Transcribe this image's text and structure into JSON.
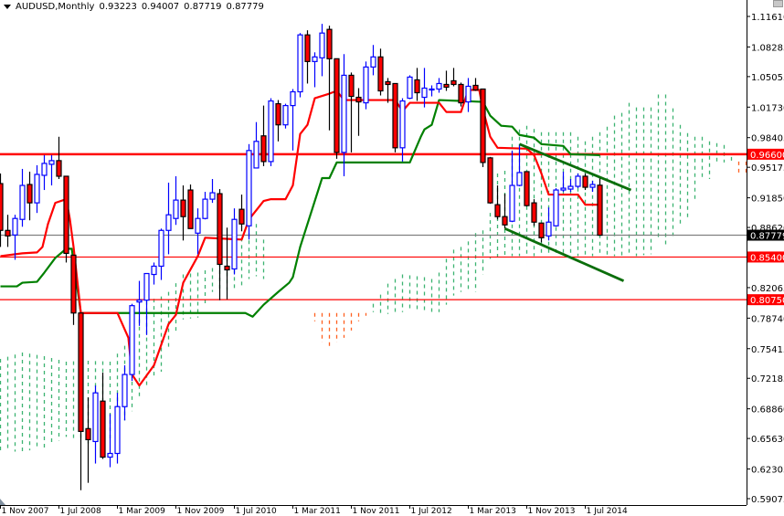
{
  "header": {
    "symbol_period": "AUDUSD,Monthly",
    "open": "0.93223",
    "high": "0.94007",
    "low": "0.87719",
    "close": "0.87779"
  },
  "colors": {
    "bull": "#0000ff",
    "bear": "#ff0000",
    "tenkan": "#ff0000",
    "kijun": "#008000",
    "cloud_bull": "#3cb371",
    "cloud_bear": "#ff6020",
    "trend": "#0b6e0b",
    "level": "#ff0000",
    "bid": "#808080"
  },
  "chart_data": {
    "type": "candlestick",
    "title": "AUDUSD,Monthly",
    "first_bar": "1 Nov 2007",
    "ylim": [
      0.59075,
      1.1161
    ],
    "y_ticks": [
      "1.11610",
      "1.08285",
      "1.05055",
      "1.01730",
      "0.98405",
      "0.95175",
      "0.91850",
      "0.88620",
      "0.82065",
      "0.78740",
      "0.75415",
      "0.72185",
      "0.68860",
      "0.65630",
      "0.62305",
      "0.59075"
    ],
    "x_ticks": [
      {
        "label": "1 Nov 2007",
        "bar": 0
      },
      {
        "label": "1 Jul 2008",
        "bar": 8
      },
      {
        "label": "1 Mar 2009",
        "bar": 16
      },
      {
        "label": "1 Nov 2009",
        "bar": 24
      },
      {
        "label": "1 Jul 2010",
        "bar": 32
      },
      {
        "label": "1 Mar 2011",
        "bar": 40
      },
      {
        "label": "1 Nov 2011",
        "bar": 48
      },
      {
        "label": "1 Jul 2012",
        "bar": 56
      },
      {
        "label": "1 Mar 2013",
        "bar": 64
      },
      {
        "label": "1 Nov 2013",
        "bar": 72
      },
      {
        "label": "1 Jul 2014",
        "bar": 80
      }
    ],
    "candles_ohlc": [
      [
        0.934,
        0.945,
        0.865,
        0.883
      ],
      [
        0.883,
        0.9,
        0.865,
        0.877
      ],
      [
        0.878,
        0.9,
        0.851,
        0.896
      ],
      [
        0.895,
        0.95,
        0.887,
        0.932
      ],
      [
        0.933,
        0.947,
        0.894,
        0.913
      ],
      [
        0.913,
        0.954,
        0.902,
        0.944
      ],
      [
        0.943,
        0.965,
        0.927,
        0.956
      ],
      [
        0.955,
        0.965,
        0.932,
        0.959
      ],
      [
        0.959,
        0.985,
        0.939,
        0.942
      ],
      [
        0.942,
        0.942,
        0.848,
        0.858
      ],
      [
        0.856,
        0.856,
        0.78,
        0.793
      ],
      [
        0.793,
        0.793,
        0.6,
        0.664
      ],
      [
        0.667,
        0.701,
        0.608,
        0.655
      ],
      [
        0.653,
        0.714,
        0.629,
        0.706
      ],
      [
        0.697,
        0.728,
        0.634,
        0.636
      ],
      [
        0.636,
        0.683,
        0.625,
        0.64
      ],
      [
        0.64,
        0.706,
        0.629,
        0.691
      ],
      [
        0.691,
        0.736,
        0.676,
        0.726
      ],
      [
        0.726,
        0.803,
        0.719,
        0.801
      ],
      [
        0.805,
        0.828,
        0.779,
        0.807
      ],
      [
        0.807,
        0.836,
        0.769,
        0.836
      ],
      [
        0.835,
        0.848,
        0.824,
        0.844
      ],
      [
        0.844,
        0.885,
        0.829,
        0.883
      ],
      [
        0.883,
        0.935,
        0.857,
        0.9
      ],
      [
        0.896,
        0.942,
        0.889,
        0.916
      ],
      [
        0.916,
        0.932,
        0.872,
        0.898
      ],
      [
        0.927,
        0.933,
        0.885,
        0.885
      ],
      [
        0.88,
        0.907,
        0.857,
        0.896
      ],
      [
        0.896,
        0.925,
        0.895,
        0.917
      ],
      [
        0.917,
        0.939,
        0.913,
        0.924
      ],
      [
        0.923,
        0.928,
        0.807,
        0.846
      ],
      [
        0.844,
        0.886,
        0.808,
        0.84
      ],
      [
        0.841,
        0.907,
        0.835,
        0.895
      ],
      [
        0.906,
        0.922,
        0.882,
        0.89
      ],
      [
        0.888,
        0.977,
        0.873,
        0.97
      ],
      [
        0.951,
        1.001,
        0.951,
        0.98
      ],
      [
        0.986,
        1.019,
        0.953,
        0.958
      ],
      [
        0.958,
        1.027,
        0.953,
        1.024
      ],
      [
        1.021,
        1.025,
        0.98,
        0.998
      ],
      [
        0.998,
        1.021,
        0.994,
        1.019
      ],
      [
        1.019,
        1.037,
        0.97,
        1.034
      ],
      [
        1.034,
        1.098,
        1.028,
        1.096
      ],
      [
        1.096,
        1.101,
        1.043,
        1.067
      ],
      [
        1.067,
        1.077,
        1.039,
        1.072
      ],
      [
        1.071,
        1.108,
        1.051,
        1.098
      ],
      [
        1.102,
        1.106,
        0.992,
        1.07
      ],
      [
        1.07,
        1.07,
        0.961,
        0.968
      ],
      [
        0.968,
        1.075,
        0.942,
        1.052
      ],
      [
        1.052,
        1.055,
        0.968,
        1.029
      ],
      [
        1.028,
        1.038,
        0.986,
        1.023
      ],
      [
        1.022,
        1.067,
        1.015,
        1.061
      ],
      [
        1.061,
        1.085,
        1.052,
        1.072
      ],
      [
        1.072,
        1.081,
        1.03,
        1.035
      ],
      [
        1.045,
        1.049,
        1.022,
        1.042
      ],
      [
        1.043,
        1.043,
        0.968,
        0.973
      ],
      [
        0.973,
        1.027,
        0.958,
        1.024
      ],
      [
        1.027,
        1.052,
        1.026,
        1.05
      ],
      [
        1.047,
        1.06,
        1.024,
        1.033
      ],
      [
        1.028,
        1.06,
        1.017,
        1.038
      ],
      [
        1.036,
        1.041,
        1.029,
        1.037
      ],
      [
        1.037,
        1.049,
        1.033,
        1.043
      ],
      [
        1.042,
        1.057,
        1.035,
        1.039
      ],
      [
        1.046,
        1.06,
        1.04,
        1.042
      ],
      [
        1.042,
        1.044,
        1.018,
        1.022
      ],
      [
        1.023,
        1.049,
        1.012,
        1.04
      ],
      [
        1.041,
        1.049,
        1.035,
        1.036
      ],
      [
        1.037,
        1.037,
        0.952,
        0.957
      ],
      [
        0.962,
        0.963,
        0.912,
        0.913
      ],
      [
        0.911,
        0.932,
        0.895,
        0.898
      ],
      [
        0.898,
        0.923,
        0.885,
        0.889
      ],
      [
        0.893,
        0.97,
        0.892,
        0.932
      ],
      [
        0.932,
        0.977,
        0.931,
        0.946
      ],
      [
        0.947,
        0.947,
        0.909,
        0.91
      ],
      [
        0.913,
        0.917,
        0.888,
        0.892
      ],
      [
        0.891,
        0.891,
        0.87,
        0.875
      ],
      [
        0.877,
        0.908,
        0.872,
        0.892
      ],
      [
        0.888,
        0.929,
        0.887,
        0.927
      ],
      [
        0.927,
        0.947,
        0.925,
        0.929
      ],
      [
        0.928,
        0.939,
        0.925,
        0.931
      ],
      [
        0.931,
        0.945,
        0.929,
        0.942
      ],
      [
        0.942,
        0.945,
        0.927,
        0.93
      ],
      [
        0.93,
        0.937,
        0.925,
        0.933
      ],
      [
        0.93223,
        0.94007,
        0.87719,
        0.87779
      ]
    ],
    "tenkan_sen": [
      [
        0,
        0.855
      ],
      [
        3,
        0.858
      ],
      [
        5,
        0.859
      ],
      [
        5.75,
        0.865
      ],
      [
        6.5,
        0.89
      ],
      [
        7.5,
        0.913
      ],
      [
        9,
        0.917
      ],
      [
        9.5,
        0.895
      ],
      [
        10,
        0.865
      ],
      [
        11,
        0.793
      ],
      [
        16,
        0.793
      ],
      [
        17.5,
        0.766
      ],
      [
        18,
        0.726
      ],
      [
        19,
        0.714
      ],
      [
        21,
        0.736
      ],
      [
        23,
        0.781
      ],
      [
        24,
        0.791
      ],
      [
        25,
        0.826
      ],
      [
        27,
        0.855
      ],
      [
        28,
        0.875
      ],
      [
        33,
        0.873
      ],
      [
        34,
        0.895
      ],
      [
        35,
        0.905
      ],
      [
        36,
        0.915
      ],
      [
        37,
        0.917
      ],
      [
        39,
        0.917
      ],
      [
        40,
        0.932
      ],
      [
        41,
        0.988
      ],
      [
        42,
        0.998
      ],
      [
        43,
        1.027
      ],
      [
        45,
        1.032
      ],
      [
        46,
        1.035
      ],
      [
        47,
        1.025
      ],
      [
        54,
        1.025
      ],
      [
        55,
        1.013
      ],
      [
        56,
        1.022
      ],
      [
        60,
        1.022
      ],
      [
        61,
        1.012
      ],
      [
        63,
        1.012
      ],
      [
        64,
        1.036
      ],
      [
        65.5,
        1.036
      ],
      [
        66,
        1.015
      ],
      [
        67,
        0.985
      ],
      [
        68,
        0.973
      ],
      [
        72,
        0.972
      ],
      [
        73,
        0.965
      ],
      [
        74,
        0.945
      ],
      [
        75,
        0.922
      ],
      [
        79,
        0.922
      ],
      [
        80,
        0.911
      ],
      [
        82,
        0.911
      ]
    ],
    "kijun_sen": [
      [
        0,
        0.822
      ],
      [
        2.25,
        0.822
      ],
      [
        3,
        0.826
      ],
      [
        5,
        0.827
      ],
      [
        6,
        0.837
      ],
      [
        7.5,
        0.853
      ],
      [
        9,
        0.863
      ],
      [
        9.75,
        0.863
      ],
      [
        11,
        0.793
      ],
      [
        33.5,
        0.793
      ],
      [
        34.5,
        0.789
      ],
      [
        36,
        0.802
      ],
      [
        38,
        0.816
      ],
      [
        39.5,
        0.826
      ],
      [
        40,
        0.832
      ],
      [
        41,
        0.865
      ],
      [
        42,
        0.89
      ],
      [
        43,
        0.915
      ],
      [
        44,
        0.94
      ],
      [
        45,
        0.94
      ],
      [
        46,
        0.957
      ],
      [
        56,
        0.957
      ],
      [
        57.5,
        0.985
      ],
      [
        58,
        0.993
      ],
      [
        59,
        0.998
      ],
      [
        60,
        1.025
      ],
      [
        66,
        1.023
      ],
      [
        67,
        1.008
      ],
      [
        68.5,
        0.997
      ],
      [
        70,
        0.996
      ],
      [
        71,
        0.987
      ],
      [
        73,
        0.984
      ],
      [
        74,
        0.977
      ],
      [
        77,
        0.975
      ],
      [
        78,
        0.966
      ],
      [
        82,
        0.965
      ]
    ],
    "cloud": [
      [
        0,
        0.743,
        0.642,
        "bull"
      ],
      [
        3,
        0.75,
        0.642,
        "bull"
      ],
      [
        6,
        0.746,
        0.646,
        "bull"
      ],
      [
        9,
        0.74,
        0.658,
        "bull"
      ],
      [
        12,
        0.741,
        0.651,
        "bull"
      ],
      [
        15,
        0.74,
        0.656,
        "bull"
      ],
      [
        18,
        0.766,
        0.686,
        "bull"
      ],
      [
        20,
        0.806,
        0.713,
        "bull"
      ],
      [
        22,
        0.811,
        0.729,
        "bull"
      ],
      [
        23,
        0.816,
        0.756,
        "bull"
      ],
      [
        25,
        0.835,
        0.786,
        "bull"
      ],
      [
        27,
        0.837,
        0.788,
        "bull"
      ],
      [
        29,
        0.842,
        0.816,
        "bull"
      ],
      [
        31,
        0.853,
        0.818,
        "bull"
      ],
      [
        33,
        0.875,
        0.822,
        "bull"
      ],
      [
        34,
        0.88,
        0.83,
        "bull"
      ],
      [
        35,
        0.89,
        0.833,
        "bull"
      ],
      [
        36,
        0.873,
        0.83,
        "bull"
      ],
      [
        37,
        0.85,
        0.85,
        "none"
      ],
      [
        42,
        0.8,
        0.8,
        "none"
      ],
      [
        43,
        0.793,
        0.784,
        "bear"
      ],
      [
        44,
        0.793,
        0.761,
        "bear"
      ],
      [
        45,
        0.793,
        0.754,
        "bear"
      ],
      [
        46,
        0.793,
        0.761,
        "bear"
      ],
      [
        47,
        0.793,
        0.766,
        "bear"
      ],
      [
        48,
        0.793,
        0.774,
        "bear"
      ],
      [
        49,
        0.793,
        0.784,
        "bear"
      ],
      [
        50,
        0.793,
        0.79,
        "bear"
      ],
      [
        51,
        0.803,
        0.794,
        "bull"
      ],
      [
        52,
        0.813,
        0.793,
        "bull"
      ],
      [
        53,
        0.825,
        0.792,
        "bull"
      ],
      [
        55,
        0.835,
        0.794,
        "bull"
      ],
      [
        58,
        0.832,
        0.795,
        "bull"
      ],
      [
        59,
        0.83,
        0.794,
        "bull"
      ],
      [
        60,
        0.837,
        0.794,
        "bull"
      ],
      [
        61,
        0.852,
        0.802,
        "bull"
      ],
      [
        62,
        0.862,
        0.812,
        "bull"
      ],
      [
        63,
        0.865,
        0.816,
        "bull"
      ],
      [
        64,
        0.871,
        0.816,
        "bull"
      ],
      [
        65,
        0.88,
        0.816,
        "bull"
      ],
      [
        66,
        0.883,
        0.835,
        "bull"
      ],
      [
        67,
        0.902,
        0.852,
        "bull"
      ],
      [
        68,
        0.945,
        0.852,
        "bull"
      ],
      [
        69,
        0.948,
        0.855,
        "bull"
      ],
      [
        70,
        0.985,
        0.855,
        "bull"
      ],
      [
        71,
        0.993,
        0.855,
        "bull"
      ],
      [
        72,
        0.997,
        0.855,
        "bull"
      ],
      [
        74,
        0.99,
        0.855,
        "bull"
      ],
      [
        78,
        0.99,
        0.855,
        "bull"
      ],
      [
        79,
        0.985,
        0.855,
        "bull"
      ],
      [
        80,
        0.98,
        0.855,
        "bull"
      ],
      [
        81,
        0.985,
        0.855,
        "bull"
      ],
      [
        82,
        0.99,
        0.855,
        "bull"
      ],
      [
        83,
        0.996,
        0.855,
        "bull"
      ],
      [
        84,
        1.008,
        0.855,
        "bull"
      ],
      [
        85,
        1.011,
        0.855,
        "bull"
      ],
      [
        86,
        1.022,
        0.855,
        "bull"
      ],
      [
        87,
        1.017,
        0.855,
        "bull"
      ],
      [
        89,
        1.017,
        0.857,
        "bull"
      ],
      [
        90,
        1.031,
        0.875,
        "bull"
      ],
      [
        91,
        1.031,
        0.866,
        "bull"
      ],
      [
        92,
        1.016,
        0.877,
        "bull"
      ],
      [
        93,
        0.998,
        0.887,
        "bull"
      ],
      [
        94,
        0.989,
        0.896,
        "bull"
      ],
      [
        95,
        0.985,
        0.917,
        "bull"
      ],
      [
        96,
        0.985,
        0.938,
        "bull"
      ],
      [
        97,
        0.98,
        0.939,
        "bull"
      ],
      [
        98,
        0.978,
        0.957,
        "bull"
      ],
      [
        99,
        0.976,
        0.957,
        "bull"
      ],
      [
        100,
        0.963,
        0.957,
        "bull"
      ],
      [
        101,
        0.958,
        0.945,
        "bear"
      ],
      [
        102,
        0.958,
        0.945,
        "bear"
      ]
    ],
    "trendlines": [
      {
        "name": "upper-channel",
        "from": [
          71,
          0.977
        ],
        "to": [
          86.25,
          0.927
        ]
      },
      {
        "name": "lower-channel",
        "from": [
          69,
          0.885
        ],
        "to": [
          85.25,
          0.828
        ]
      }
    ],
    "levels": [
      {
        "price": 0.966,
        "label": "0.96600",
        "style": "resistance",
        "thick": true
      },
      {
        "price": 0.854,
        "label": "0.85400",
        "style": "support",
        "thick": false
      },
      {
        "price": 0.8075,
        "label": "0.80750",
        "style": "support",
        "thick": false
      },
      {
        "price": 0.87779,
        "label": "0.87779",
        "style": "bid",
        "thick": false
      }
    ]
  }
}
